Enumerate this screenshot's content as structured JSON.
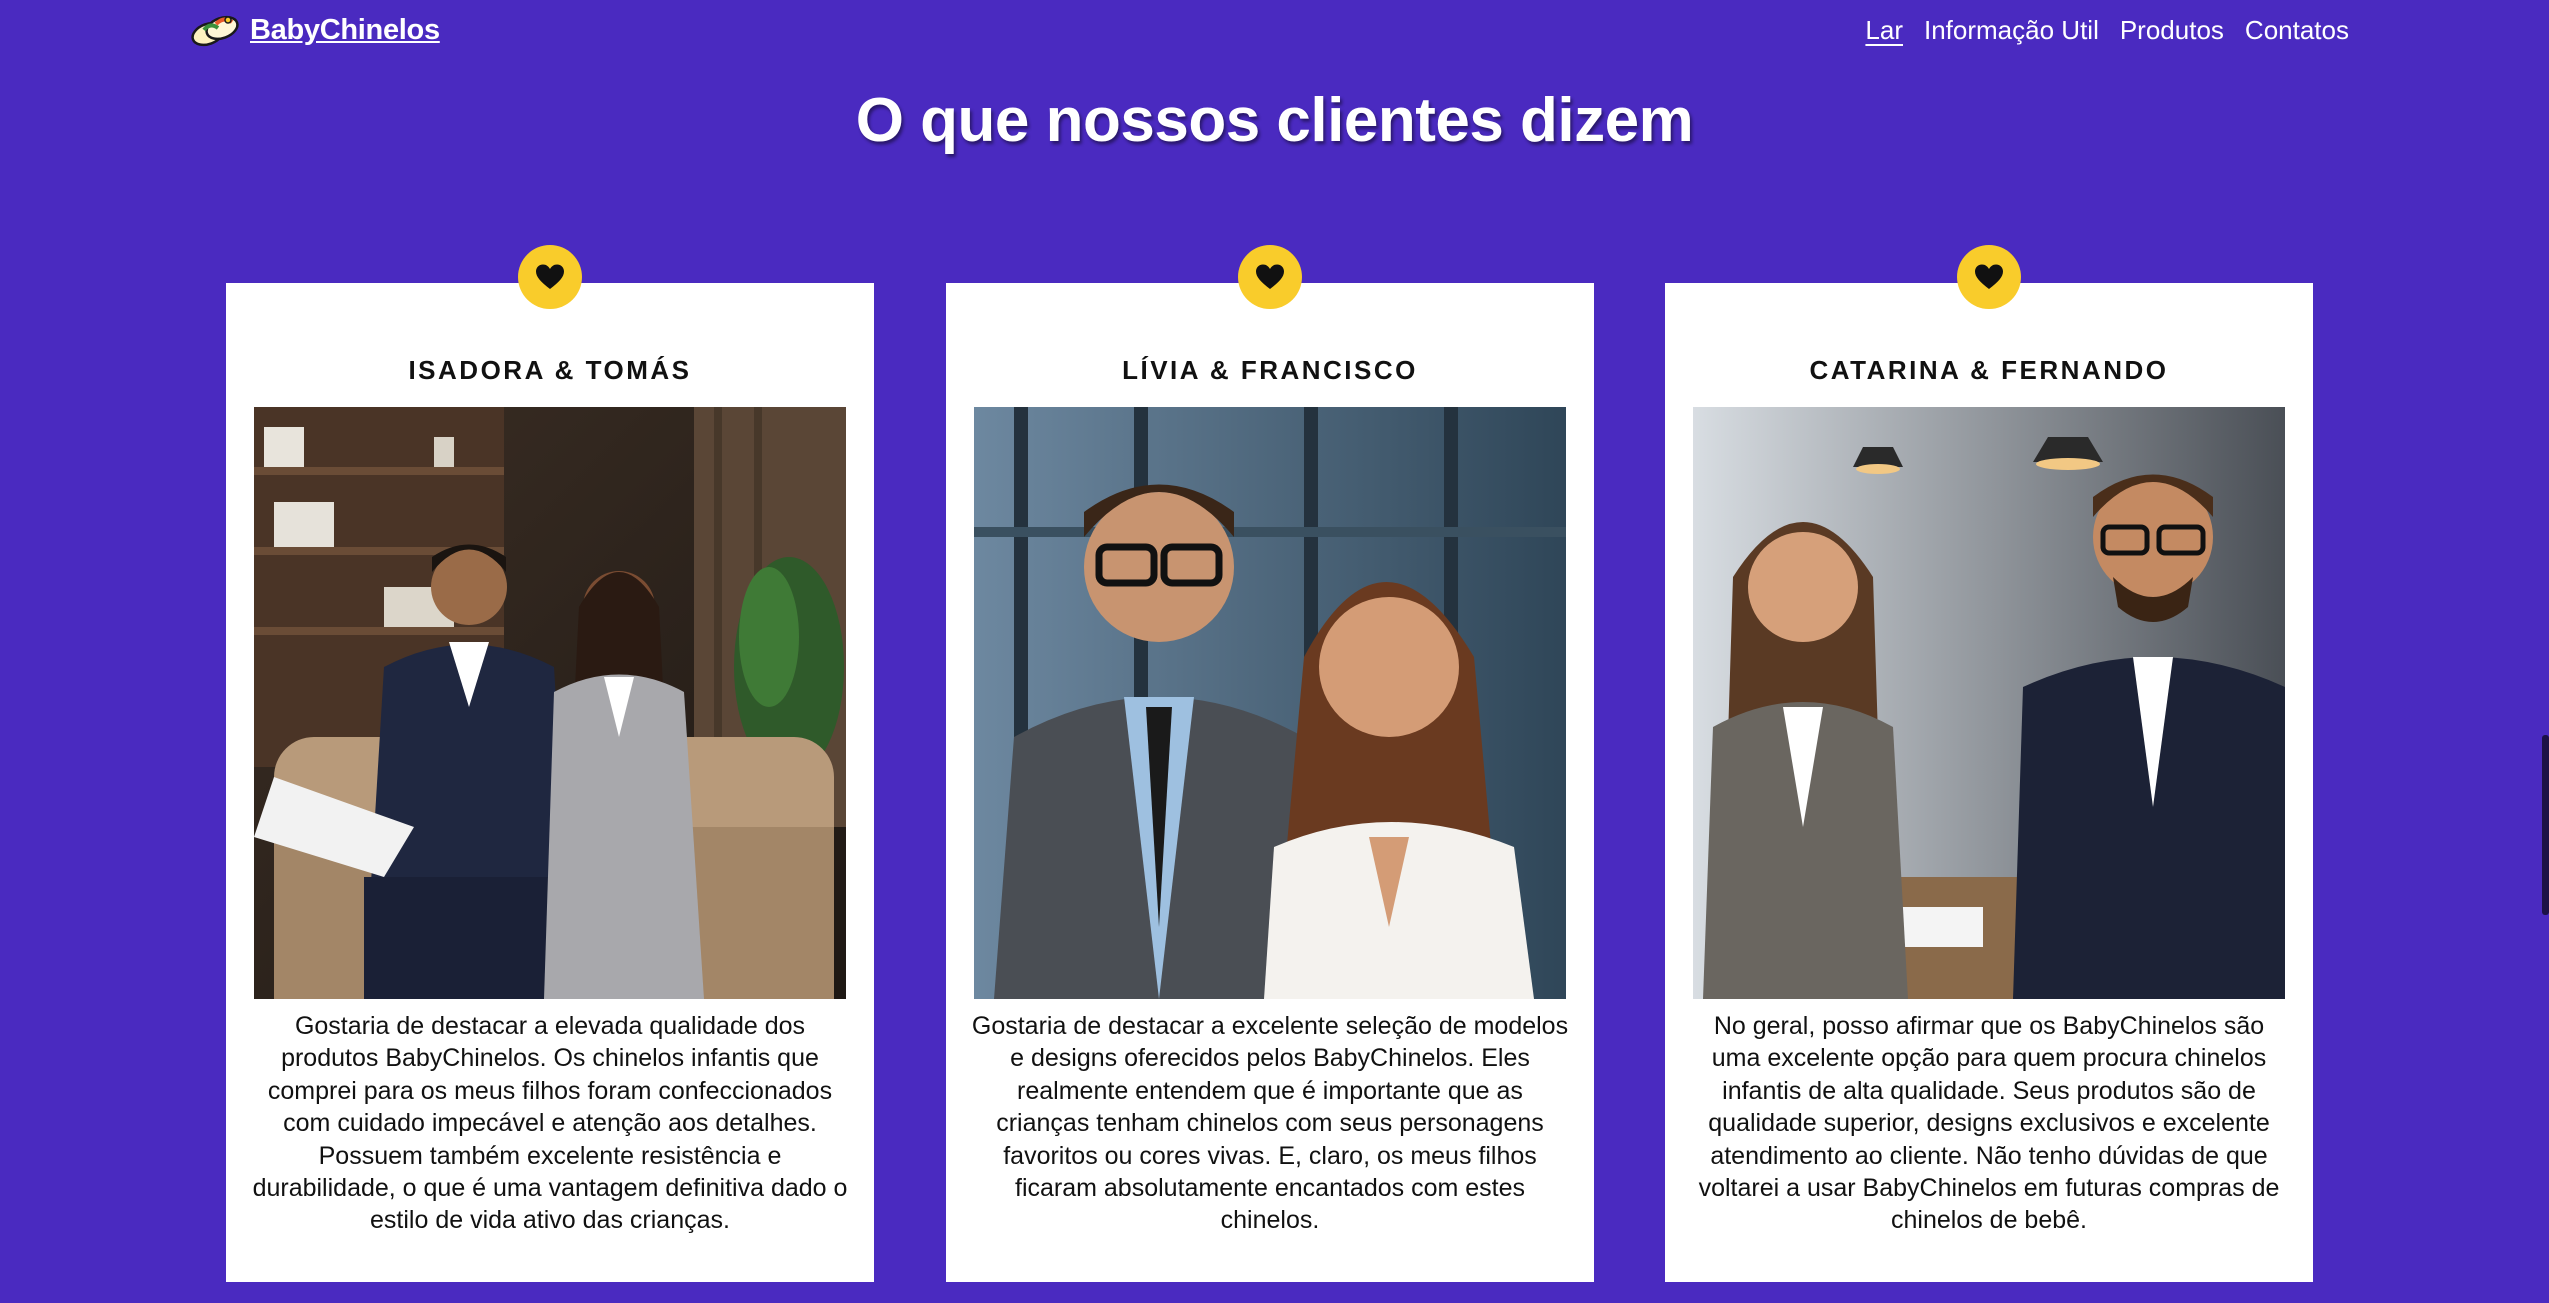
{
  "brand": {
    "name": "BabyChinelos",
    "logo_icon": "slippers-logo-icon"
  },
  "nav": {
    "items": [
      {
        "label": "Lar",
        "active": true
      },
      {
        "label": "Informação Util",
        "active": false
      },
      {
        "label": "Produtos",
        "active": false
      },
      {
        "label": "Contatos",
        "active": false
      }
    ]
  },
  "section": {
    "title": "O que nossos clientes dizem"
  },
  "testimonials": [
    {
      "name": "ISADORA & TOMÁS",
      "badge_icon": "heart-icon",
      "photo_icon": "couple-photo-icon",
      "quote": "Gostaria de destacar a elevada qualidade dos produtos BabyChinelos. Os chinelos infantis que comprei para os meus filhos foram confeccionados com cuidado impecável e atenção aos detalhes. Possuem também excelente resistência e durabilidade, o que é uma vantagem definitiva dado o estilo de vida ativo das crianças."
    },
    {
      "name": "LÍVIA & FRANCISCO",
      "badge_icon": "heart-icon",
      "photo_icon": "couple-photo-icon",
      "quote": "Gostaria de destacar a excelente seleção de modelos e designs oferecidos pelos BabyChinelos. Eles realmente entendem que é importante que as crianças tenham chinelos com seus personagens favoritos ou cores vivas. E, claro, os meus filhos ficaram absolutamente encantados com estes chinelos."
    },
    {
      "name": "CATARINA & FERNANDO",
      "badge_icon": "heart-icon",
      "photo_icon": "couple-photo-icon",
      "quote": "No geral, posso afirmar que os BabyChinelos são uma excelente opção para quem procura chinelos infantis de alta qualidade. Seus produtos são de qualidade superior, designs exclusivos e excelente atendimento ao cliente. Não tenho dúvidas de que voltarei a usar BabyChinelos em futuras compras de chinelos de bebê."
    }
  ],
  "colors": {
    "background": "#4a2ac0",
    "card": "#ffffff",
    "badge": "#f9cc2b",
    "text": "#111111",
    "header_text": "#ffffff"
  }
}
